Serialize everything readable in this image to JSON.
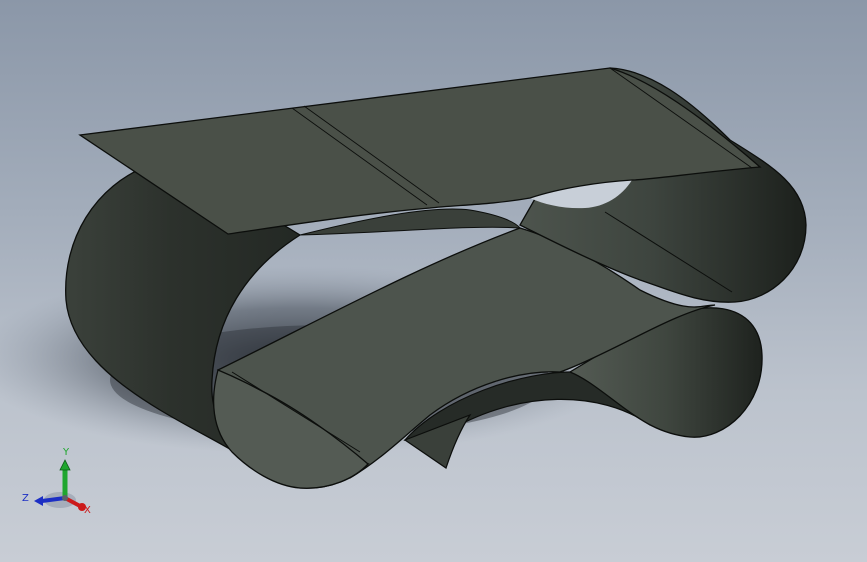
{
  "viewport": {
    "background_top": "#8b97a8",
    "background_bottom": "#c8cdd5"
  },
  "model": {
    "part": "sheet-metal-clip",
    "surface_color": "#4a5048",
    "surface_dark": "#262b27",
    "surface_light": "#59605a",
    "edge_color": "#0c0e0c"
  },
  "triad": {
    "x_label": "X",
    "y_label": "Y",
    "z_label": "Z",
    "x_color": "#cc1a1a",
    "y_color": "#1fa62e",
    "z_color": "#1c2fc4"
  }
}
